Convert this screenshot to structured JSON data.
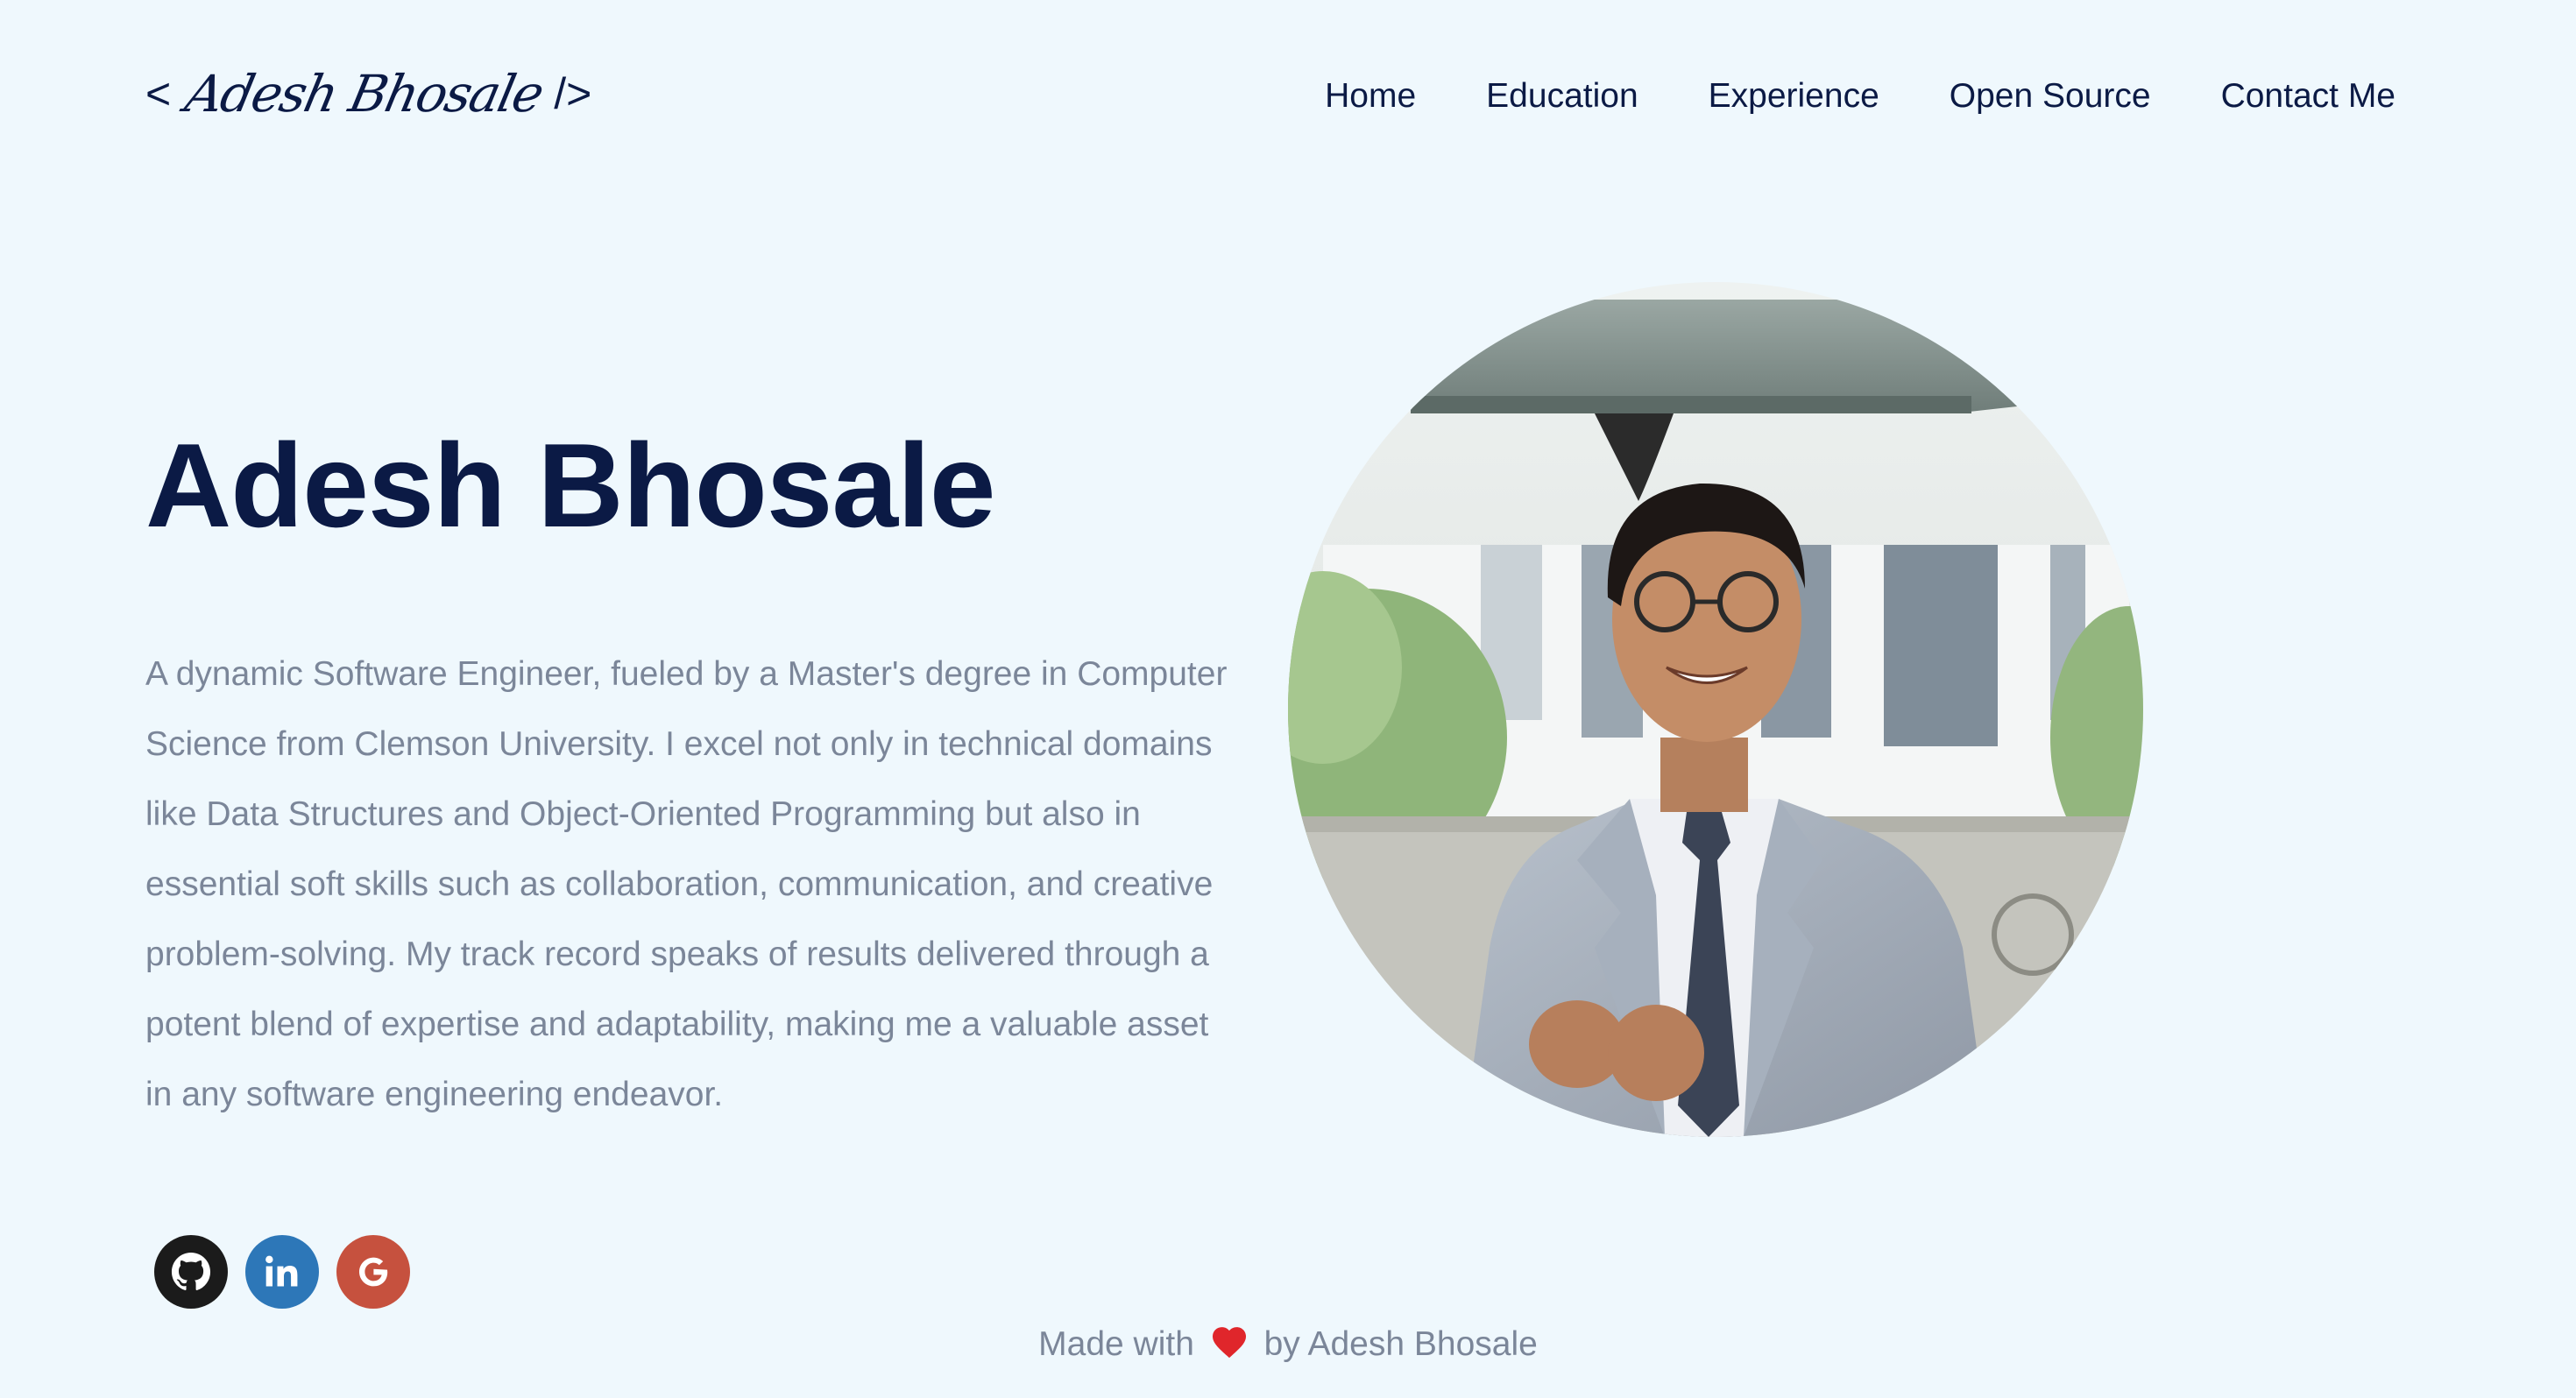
{
  "logo": {
    "open_bracket": "<",
    "signature": "Adesh Bhosale",
    "close_bracket": "/>"
  },
  "nav": {
    "items": [
      {
        "label": "Home"
      },
      {
        "label": "Education"
      },
      {
        "label": "Experience"
      },
      {
        "label": "Open Source"
      },
      {
        "label": "Contact Me"
      }
    ]
  },
  "hero": {
    "name": "Adesh Bhosale",
    "bio": "A dynamic Software Engineer, fueled by a Master's degree in Computer Science from Clemson University. I excel not only in technical domains like Data Structures and Object-Oriented Programming but also in essential soft skills such as collaboration, communication, and creative problem-solving. My track record speaks of results delivered through a potent blend of expertise and adaptability, making me a valuable asset in any software engineering endeavor."
  },
  "socials": [
    {
      "icon": "github-icon",
      "color": "#1b1b1b"
    },
    {
      "icon": "linkedin-icon",
      "color": "#2d77b8"
    },
    {
      "icon": "google-icon",
      "color": "#c6513e"
    }
  ],
  "portrait": {
    "icon": "profile-photo"
  },
  "footer": {
    "prefix": "Made with",
    "heart_icon": "heart-icon",
    "suffix": "by Adesh Bhosale"
  },
  "colors": {
    "background": "#eff8fd",
    "heading": "#0b1a45",
    "body_text": "#7b8699",
    "heart": "#e0262b"
  }
}
